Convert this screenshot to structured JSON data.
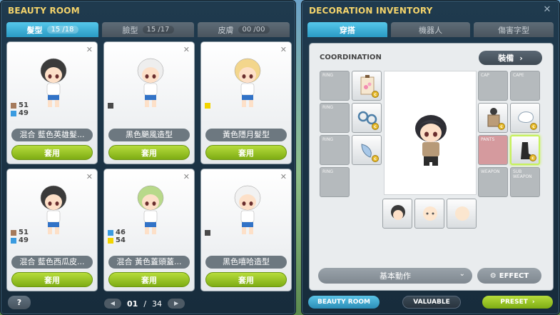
{
  "beauty_room": {
    "title": "BEAUTY ROOM",
    "tabs": [
      {
        "label": "髮型",
        "count": "15 /18",
        "active": true
      },
      {
        "label": "臉型",
        "count": "15 /17",
        "active": false
      },
      {
        "label": "皮膚",
        "count": "00 /00",
        "active": false
      }
    ],
    "cards": [
      {
        "name": "混合 藍色英雄髮...",
        "swatches": [
          {
            "color": "#a57a5c",
            "value": "51"
          },
          {
            "color": "#3a9be0",
            "value": "49"
          }
        ],
        "hair": "#3b3b3b",
        "apply": "套用"
      },
      {
        "name": "黑色颶風造型",
        "swatches": [
          {
            "color": "#4a4a4a",
            "value": ""
          }
        ],
        "hair": "#eeeeee",
        "apply": "套用"
      },
      {
        "name": "黃色隱月髮型",
        "swatches": [
          {
            "color": "#f2d400",
            "value": ""
          }
        ],
        "hair": "#f3d68c",
        "apply": "套用"
      },
      {
        "name": "混合 藍色西瓜皮...",
        "swatches": [
          {
            "color": "#a57a5c",
            "value": "51"
          },
          {
            "color": "#3a9be0",
            "value": "49"
          }
        ],
        "hair": "#3a3a3a",
        "apply": "套用"
      },
      {
        "name": "混合 黃色蓋頭蓋...",
        "swatches": [
          {
            "color": "#3a9be0",
            "value": "46"
          },
          {
            "color": "#f2d400",
            "value": "54"
          }
        ],
        "hair": "#b8d98a",
        "apply": "套用"
      },
      {
        "name": "黑色嘻哈造型",
        "swatches": [
          {
            "color": "#4a4a4a",
            "value": ""
          }
        ],
        "hair": "#f2f2f2",
        "apply": "套用"
      }
    ],
    "help": "?",
    "pager": {
      "current": "01",
      "separator": "/",
      "total": "34"
    }
  },
  "decoration": {
    "title": "DECORATION INVENTORY",
    "tabs": [
      {
        "label": "穿搭",
        "active": true
      },
      {
        "label": "機器人",
        "active": false
      },
      {
        "label": "傷害字型",
        "active": false
      }
    ],
    "coordination_label": "COORDINATION",
    "equip_label": "裝備",
    "slots": {
      "ring1": "RING",
      "ring2": "RING",
      "ring3": "RING",
      "ring4": "RING",
      "cap": "CAP",
      "cape": "CAPE",
      "pants": "PANTS",
      "weapon": "WEAPON",
      "subweapon": "SUB WEAPON"
    },
    "motion_select": "基本動作",
    "effect_label": "EFFECT",
    "buttons": {
      "beauty_room": "BEAUTY ROOM",
      "valuable": "VALUABLE",
      "preset": "PRESET"
    },
    "colors": {
      "accent_blue": "#2a9ac4",
      "accent_green": "#8bbb1a",
      "title_gold": "#f3d36b"
    }
  }
}
